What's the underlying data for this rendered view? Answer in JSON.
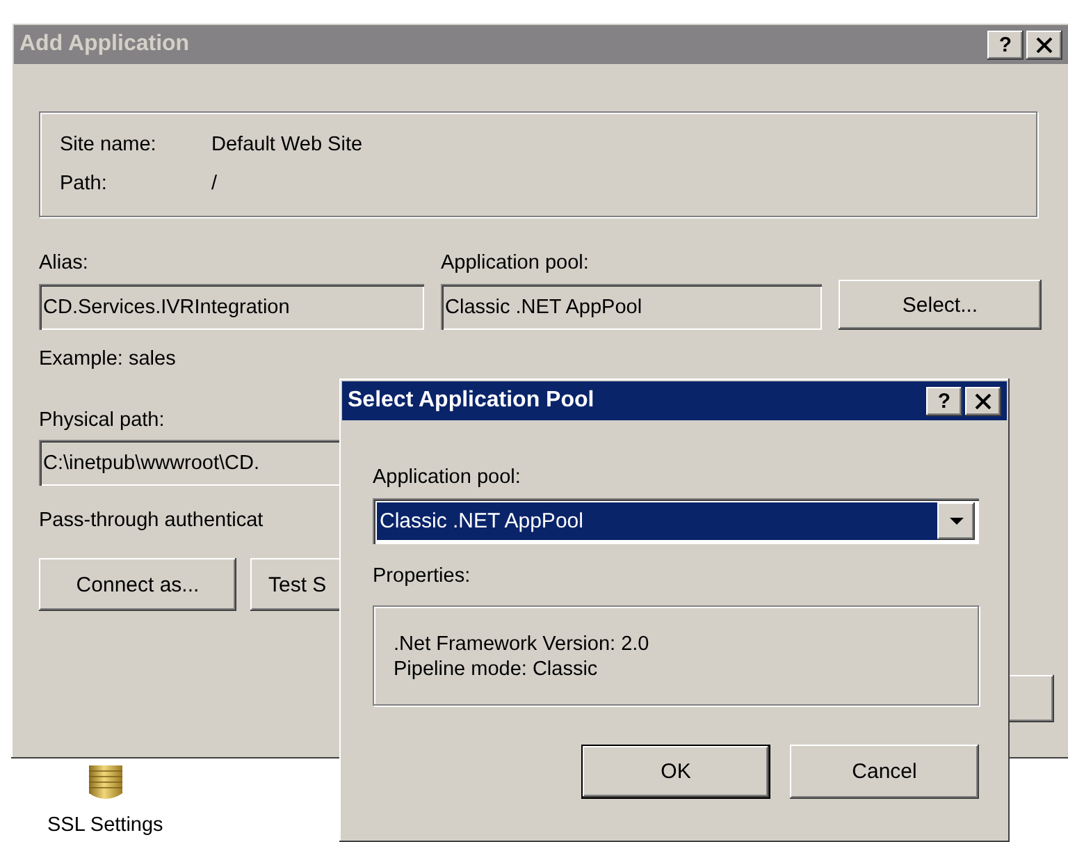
{
  "main_window": {
    "title": "Add Application",
    "active": false,
    "help_glyph": "?",
    "site": {
      "name_label": "Site name:",
      "name_value": "Default Web Site",
      "path_label": "Path:",
      "path_value": "/"
    },
    "alias": {
      "label": "Alias:",
      "value": "CD.Services.IVRIntegration"
    },
    "app_pool": {
      "label": "Application pool:",
      "value": "Classic .NET AppPool"
    },
    "select_button": "Select...",
    "example": "Example: sales",
    "physical_path": {
      "label": "Physical path:",
      "value": "C:\\inetpub\\wwwroot\\CD."
    },
    "pass_through": "Pass-through authenticat",
    "buttons": [
      "Connect as...",
      "Test S"
    ]
  },
  "dialog": {
    "title": "Select Application Pool",
    "active": true,
    "help_glyph": "?",
    "pool_label": "Application pool:",
    "pool_select": {
      "value": "Classic .NET AppPool",
      "focused": true
    },
    "properties_label": "Properties:",
    "properties": [
      ".Net Framework Version: 2.0",
      "Pipeline mode: Classic"
    ],
    "buttons": [
      {
        "label": "OK",
        "default": true
      },
      {
        "label": "Cancel",
        "default": false
      }
    ]
  },
  "desktop_icon": {
    "label": "SSL Settings"
  }
}
